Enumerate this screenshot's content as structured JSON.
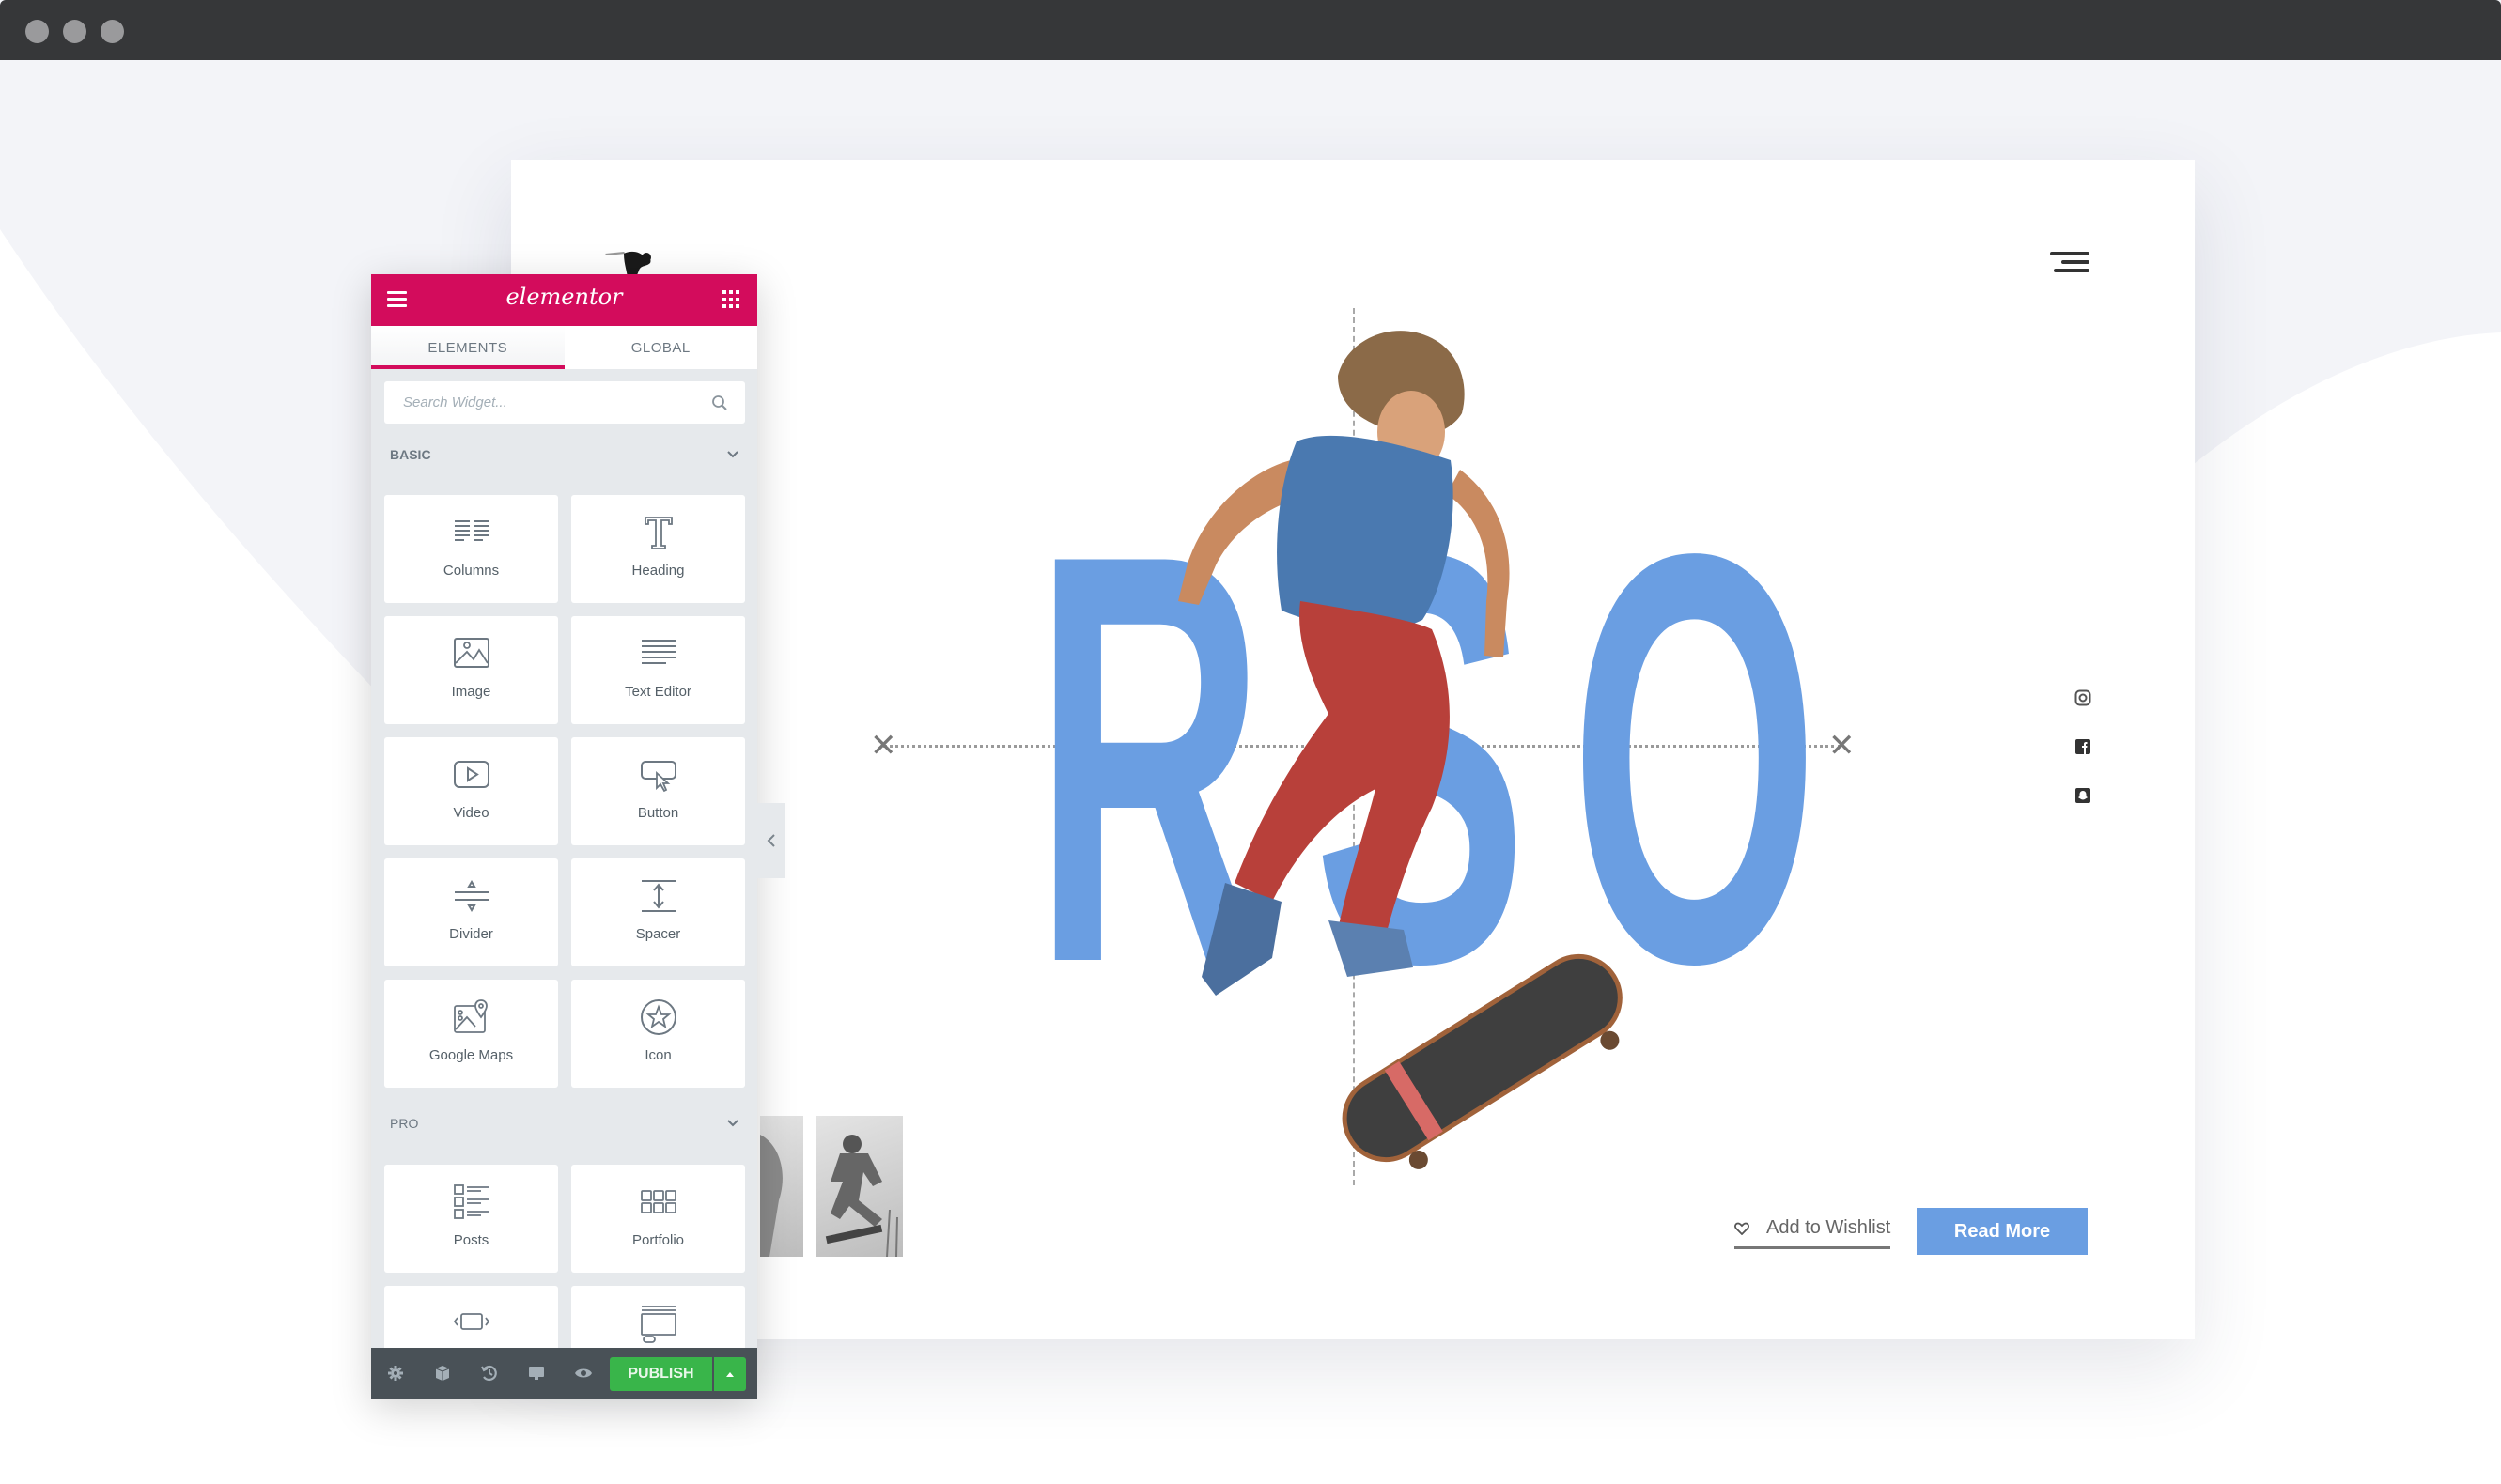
{
  "window": {
    "controls": [
      "close",
      "minimize",
      "maximize"
    ]
  },
  "editor_panel": {
    "logo_text": "elementor",
    "brand_color": "#d30c5c",
    "menu_icon": "hamburger-icon",
    "apps_icon": "grid-icon",
    "tabs": [
      {
        "label": "ELEMENTS",
        "active": true
      },
      {
        "label": "GLOBAL",
        "active": false
      }
    ],
    "search": {
      "placeholder": "Search Widget...",
      "value": ""
    },
    "categories": [
      {
        "label": "BASIC",
        "widgets": [
          {
            "label": "Columns",
            "icon": "columns-icon"
          },
          {
            "label": "Heading",
            "icon": "heading-icon"
          },
          {
            "label": "Image",
            "icon": "image-icon"
          },
          {
            "label": "Text Editor",
            "icon": "text-editor-icon"
          },
          {
            "label": "Video",
            "icon": "video-icon"
          },
          {
            "label": "Button",
            "icon": "button-icon"
          },
          {
            "label": "Divider",
            "icon": "divider-icon"
          },
          {
            "label": "Spacer",
            "icon": "spacer-icon"
          },
          {
            "label": "Google Maps",
            "icon": "google-maps-icon"
          },
          {
            "label": "Icon",
            "icon": "star-icon"
          }
        ]
      },
      {
        "label": "PRO",
        "widgets": [
          {
            "label": "Posts",
            "icon": "posts-icon"
          },
          {
            "label": "Portfolio",
            "icon": "portfolio-icon"
          },
          {
            "label": "",
            "icon": "slides-icon"
          },
          {
            "label": "",
            "icon": "form-icon"
          }
        ]
      }
    ],
    "toolbar": {
      "icons": [
        "settings-icon",
        "navigator-icon",
        "history-icon",
        "responsive-icon",
        "preview-icon"
      ],
      "publish_label": "PUBLISH",
      "publish_color": "#39b54a"
    }
  },
  "site": {
    "hero_letters": [
      "R",
      "S",
      "O"
    ],
    "accent_color": "#6a9ee2",
    "social_icons": [
      "instagram-icon",
      "facebook-icon",
      "snapchat-icon"
    ],
    "wishlist_label": "Add to Wishlist",
    "read_more_label": "Read More"
  }
}
